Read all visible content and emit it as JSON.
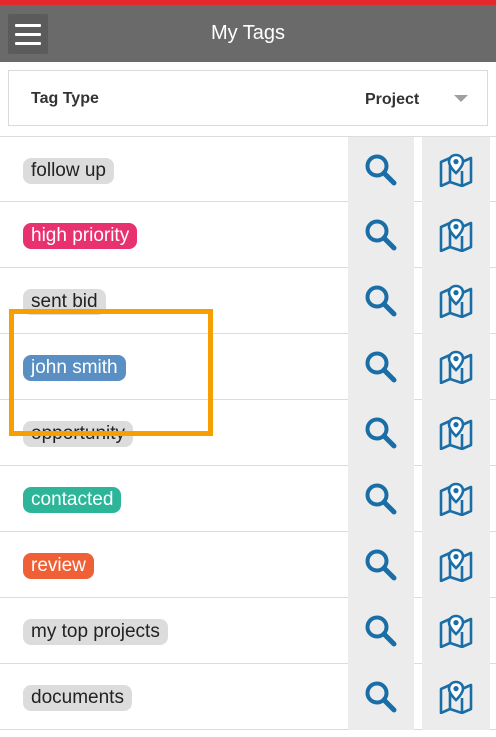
{
  "header": {
    "title": "My Tags",
    "menu_icon": "hamburger-menu-icon"
  },
  "filter": {
    "tag_type_label": "Tag Type",
    "project_label": "Project"
  },
  "colors": {
    "header_bg": "#6a6a6a",
    "accent_red": "#e5282c",
    "icon_blue": "#1a6ea8",
    "action_bg": "#ececec",
    "highlight": "#f5a000"
  },
  "tags": [
    {
      "label": "follow up",
      "color": "#dcdcdc",
      "text_color": "#222222"
    },
    {
      "label": "high priority",
      "color": "#e8316f",
      "text_color": "#ffffff"
    },
    {
      "label": "sent bid",
      "color": "#dcdcdc",
      "text_color": "#222222"
    },
    {
      "label": "john smith",
      "color": "#5a8fc3",
      "text_color": "#ffffff"
    },
    {
      "label": "opportunity",
      "color": "#dcdcdc",
      "text_color": "#222222"
    },
    {
      "label": "contacted",
      "color": "#2db59a",
      "text_color": "#ffffff"
    },
    {
      "label": "review",
      "color": "#f06036",
      "text_color": "#ffffff"
    },
    {
      "label": "my top projects",
      "color": "#dcdcdc",
      "text_color": "#222222"
    },
    {
      "label": "documents",
      "color": "#dcdcdc",
      "text_color": "#222222"
    }
  ],
  "row_icons": {
    "search": "search-icon",
    "map": "map-pin-icon"
  }
}
